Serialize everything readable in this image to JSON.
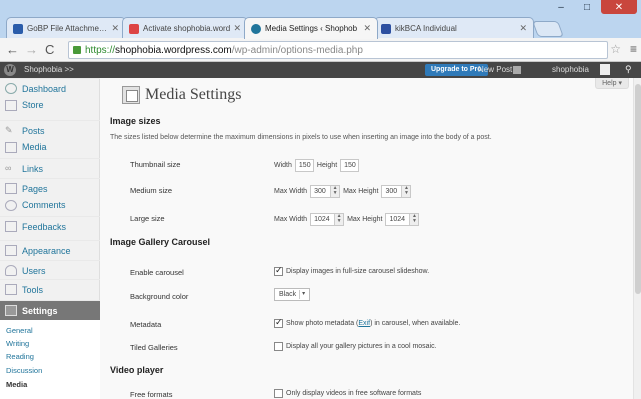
{
  "browser": {
    "tabs": [
      {
        "title": "GoBP File Attachment Ma",
        "color": "#2a5caa"
      },
      {
        "title": "Activate shophobia.word",
        "color": "#d44"
      },
      {
        "title": "Media Settings ‹ Shophob",
        "color": "#21759b"
      },
      {
        "title": "kikBCA Individual",
        "color": "#2c4fa0"
      }
    ],
    "url_scheme": "https://",
    "url_host": "shophobia.wordpress.com",
    "url_path": "/wp-admin/options-media.php"
  },
  "adminbar": {
    "site_name": "Shophobia >>",
    "upgrade_label": "Upgrade to Pro",
    "new_post_label": "New Post",
    "user_label": "shophobia"
  },
  "sidebar": {
    "items": [
      {
        "label": "Dashboard",
        "icon": "dashboard-icon"
      },
      {
        "label": "Store",
        "icon": "store-icon"
      },
      {
        "label": "Posts",
        "icon": "pin-icon"
      },
      {
        "label": "Media",
        "icon": "media-icon"
      },
      {
        "label": "Links",
        "icon": "link-icon"
      },
      {
        "label": "Pages",
        "icon": "pages-icon"
      },
      {
        "label": "Comments",
        "icon": "comments-icon"
      },
      {
        "label": "Feedbacks",
        "icon": "feedback-icon"
      },
      {
        "label": "Appearance",
        "icon": "appearance-icon"
      },
      {
        "label": "Users",
        "icon": "users-icon"
      },
      {
        "label": "Tools",
        "icon": "tools-icon"
      },
      {
        "label": "Settings",
        "icon": "settings-icon"
      }
    ],
    "submenu": [
      "General",
      "Writing",
      "Reading",
      "Discussion",
      "Media"
    ]
  },
  "main": {
    "help_label": "Help",
    "title": "Media Settings",
    "image_sizes": {
      "heading": "Image sizes",
      "description": "The sizes listed below determine the maximum dimensions in pixels to use when inserting an image into the body of a post.",
      "thumbnail": {
        "label": "Thumbnail size",
        "width_label": "Width",
        "width": "150",
        "height_label": "Height",
        "height": "150"
      },
      "medium": {
        "label": "Medium size",
        "width_label": "Max Width",
        "width": "300",
        "height_label": "Max Height",
        "height": "300"
      },
      "large": {
        "label": "Large size",
        "width_label": "Max Width",
        "width": "1024",
        "height_label": "Max Height",
        "height": "1024"
      }
    },
    "carousel": {
      "heading": "Image Gallery Carousel",
      "enable_label": "Enable carousel",
      "enable_text": "Display images in full-size carousel slideshow.",
      "enable_checked": true,
      "bg_label": "Background color",
      "bg_value": "Black",
      "metadata_label": "Metadata",
      "metadata_text_pre": "Show photo metadata (",
      "metadata_link": "Exif",
      "metadata_text_post": ") in carousel, when available.",
      "metadata_checked": true,
      "tiled_label": "Tiled Galleries",
      "tiled_text": "Display all your gallery pictures in a cool mosaic.",
      "tiled_checked": false
    },
    "video": {
      "heading": "Video player",
      "free_label": "Free formats",
      "free_text": "Only display videos in free software formats",
      "free_checked": false
    }
  }
}
